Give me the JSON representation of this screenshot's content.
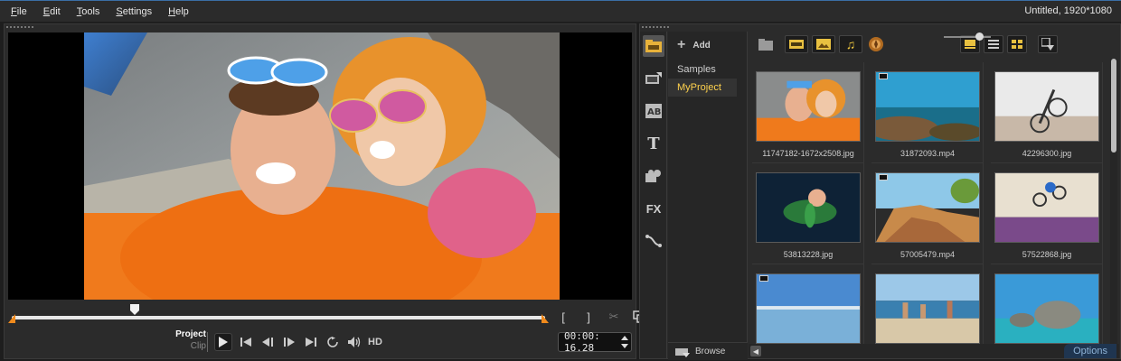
{
  "menu": {
    "items": [
      {
        "label": "File",
        "ul": "F",
        "rest": "ile"
      },
      {
        "label": "Edit",
        "ul": "E",
        "rest": "dit"
      },
      {
        "label": "Tools",
        "ul": "T",
        "rest": "ools"
      },
      {
        "label": "Settings",
        "ul": "S",
        "rest": "ettings"
      },
      {
        "label": "Help",
        "ul": "H",
        "rest": "elp"
      }
    ],
    "title": "Untitled, 1920*1080"
  },
  "player": {
    "mode_project": "Project",
    "mode_clip": "Clip",
    "hd_label": "HD",
    "timecode": "00:00: 16.28",
    "scrub_position": 0.23
  },
  "library": {
    "add_label": "Add",
    "folders": [
      {
        "label": "Samples",
        "selected": false
      },
      {
        "label": "MyProject",
        "selected": true
      }
    ],
    "browse_label": "Browse",
    "options_label": "Options",
    "zoom_level": 0.75,
    "thumbnails": [
      {
        "caption": "11747182-1672x2508.jpg",
        "video": false
      },
      {
        "caption": "31872093.mp4",
        "video": true
      },
      {
        "caption": "42296300.jpg",
        "video": false
      },
      {
        "caption": "53813228.jpg",
        "video": false
      },
      {
        "caption": "57005479.mp4",
        "video": true
      },
      {
        "caption": "57522868.jpg",
        "video": false
      },
      {
        "caption": "",
        "video": true
      },
      {
        "caption": "",
        "video": false
      },
      {
        "caption": "",
        "video": false
      }
    ]
  },
  "colors": {
    "accent": "#3a6ea5",
    "selected_folder": "#ffd24d",
    "panel": "#2b2b2b",
    "scrub_marker": "#f08a1c"
  }
}
